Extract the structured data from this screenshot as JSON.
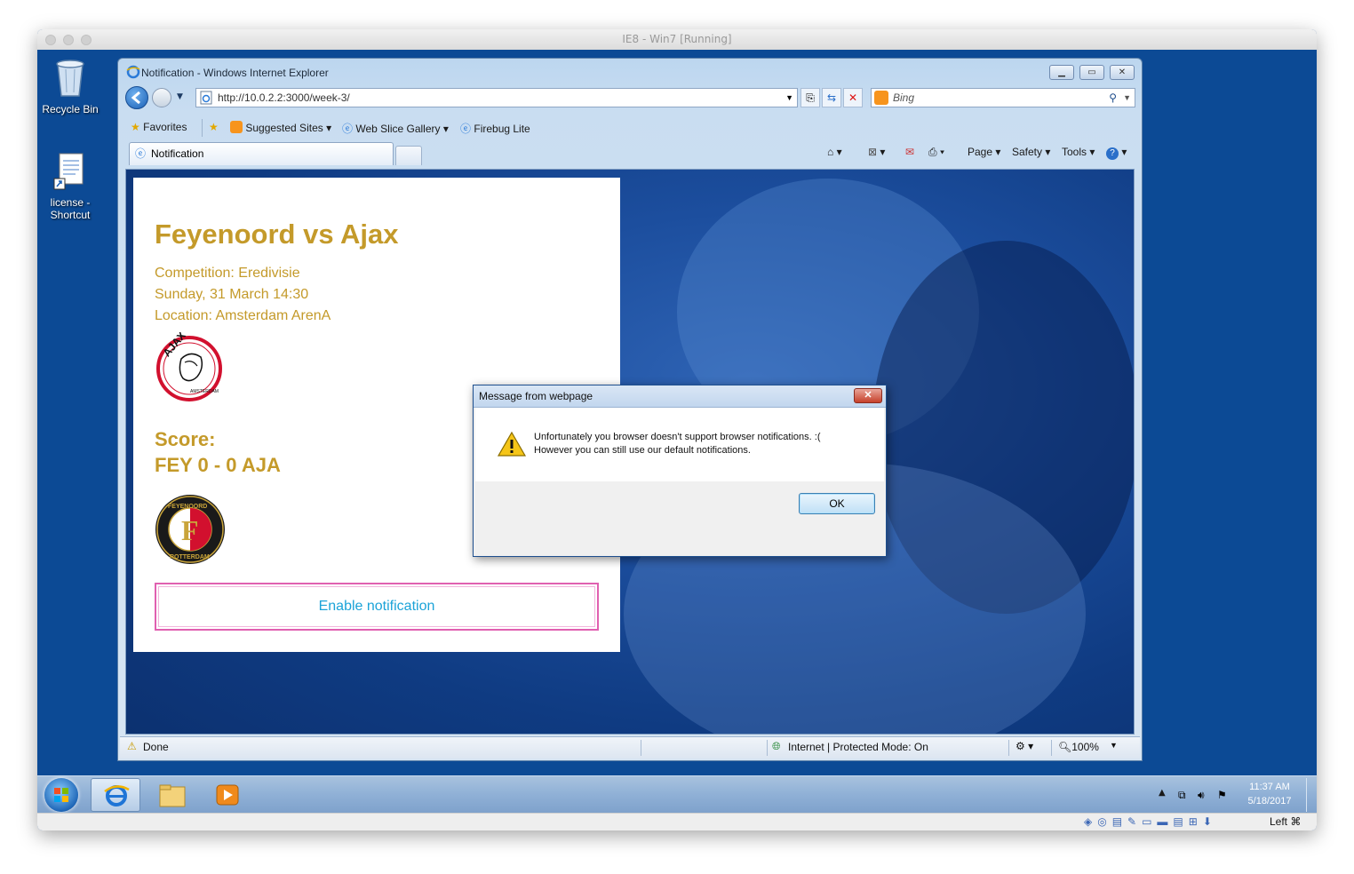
{
  "mac": {
    "title": "IE8 - Win7 [Running]"
  },
  "desktop": {
    "icons": [
      {
        "label": "Recycle Bin"
      },
      {
        "label": "license - Shortcut"
      }
    ]
  },
  "ie": {
    "window_title": "Notification - Windows Internet Explorer",
    "address": "http://10.0.2.2:3000/week-3/",
    "search_placeholder": "Bing",
    "favorites": {
      "label": "Favorites",
      "items": [
        "Suggested Sites",
        "Web Slice Gallery",
        "Firebug Lite"
      ]
    },
    "tab_label": "Notification",
    "commands": {
      "page": "Page",
      "safety": "Safety",
      "tools": "Tools"
    },
    "status": {
      "done": "Done",
      "zone": "Internet | Protected Mode: On",
      "zoom": "100%"
    }
  },
  "page": {
    "title": "Feyenoord vs Ajax",
    "competition": "Competition: Eredivisie",
    "date": "Sunday, 31 March 14:30",
    "location": "Location: Amsterdam ArenA",
    "score_label": "Score:",
    "score": "FEY 0 - 0 AJA",
    "enable_button": "Enable notification",
    "logos": {
      "ajax": {
        "ring_text": "AJAX",
        "sub_text": "AMSTERDAM"
      },
      "feyenoord": {
        "ring_text_top": "FEYENOORD",
        "ring_text_bottom": "ROTTERDAM",
        "letter": "F"
      }
    }
  },
  "dialog": {
    "title": "Message from webpage",
    "line1": "Unfortunately you browser doesn't support browser notifications. :(",
    "line2": "However you can still use our default notifications.",
    "ok": "OK"
  },
  "taskbar": {
    "time": "11:37 AM",
    "date": "5/18/2017",
    "vbox_host_key": "Left ⌘"
  },
  "colors": {
    "accent_gold": "#c49a2a",
    "button_text": "#1ba3d8",
    "button_border": "#e060b0",
    "desktop_blue": "#0c4a95"
  }
}
